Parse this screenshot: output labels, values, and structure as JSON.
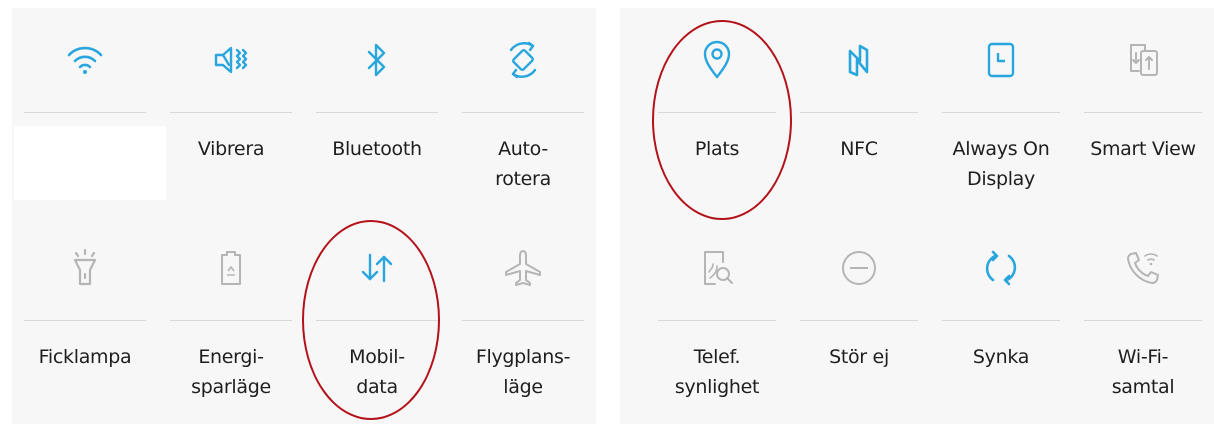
{
  "colors": {
    "active": "#29a6dd",
    "inactive": "#b5b5b5",
    "highlight": "#b3121b",
    "text": "#1e1e1e"
  },
  "left_panel": {
    "tiles": [
      {
        "label": "",
        "icon": "wifi-icon",
        "active": true
      },
      {
        "label": "Vibrera",
        "icon": "vibrate-icon",
        "active": true
      },
      {
        "label": "Bluetooth",
        "icon": "bluetooth-icon",
        "active": true
      },
      {
        "label": "Auto-\nrotera",
        "icon": "auto-rotate-icon",
        "active": true
      },
      {
        "label": "Ficklampa",
        "icon": "flashlight-icon",
        "active": false
      },
      {
        "label": "Energi-\nsparläge",
        "icon": "power-saving-icon",
        "active": false
      },
      {
        "label": "Mobil-\ndata",
        "icon": "mobile-data-icon",
        "active": true
      },
      {
        "label": "Flygplans-\nläge",
        "icon": "airplane-icon",
        "active": false
      }
    ]
  },
  "right_panel": {
    "tiles": [
      {
        "label": "Plats",
        "icon": "location-icon",
        "active": true
      },
      {
        "label": "NFC",
        "icon": "nfc-icon",
        "active": true
      },
      {
        "label": "Always On\nDisplay",
        "icon": "always-on-display-icon",
        "active": true
      },
      {
        "label": "Smart View",
        "icon": "smart-view-icon",
        "active": false
      },
      {
        "label": "Telef.\nsynlighet",
        "icon": "phone-visibility-icon",
        "active": false
      },
      {
        "label": "Stör ej",
        "icon": "do-not-disturb-icon",
        "active": false
      },
      {
        "label": "Synka",
        "icon": "sync-icon",
        "active": true
      },
      {
        "label": "Wi-Fi-\nsamtal",
        "icon": "wifi-calling-icon",
        "active": false
      }
    ]
  }
}
